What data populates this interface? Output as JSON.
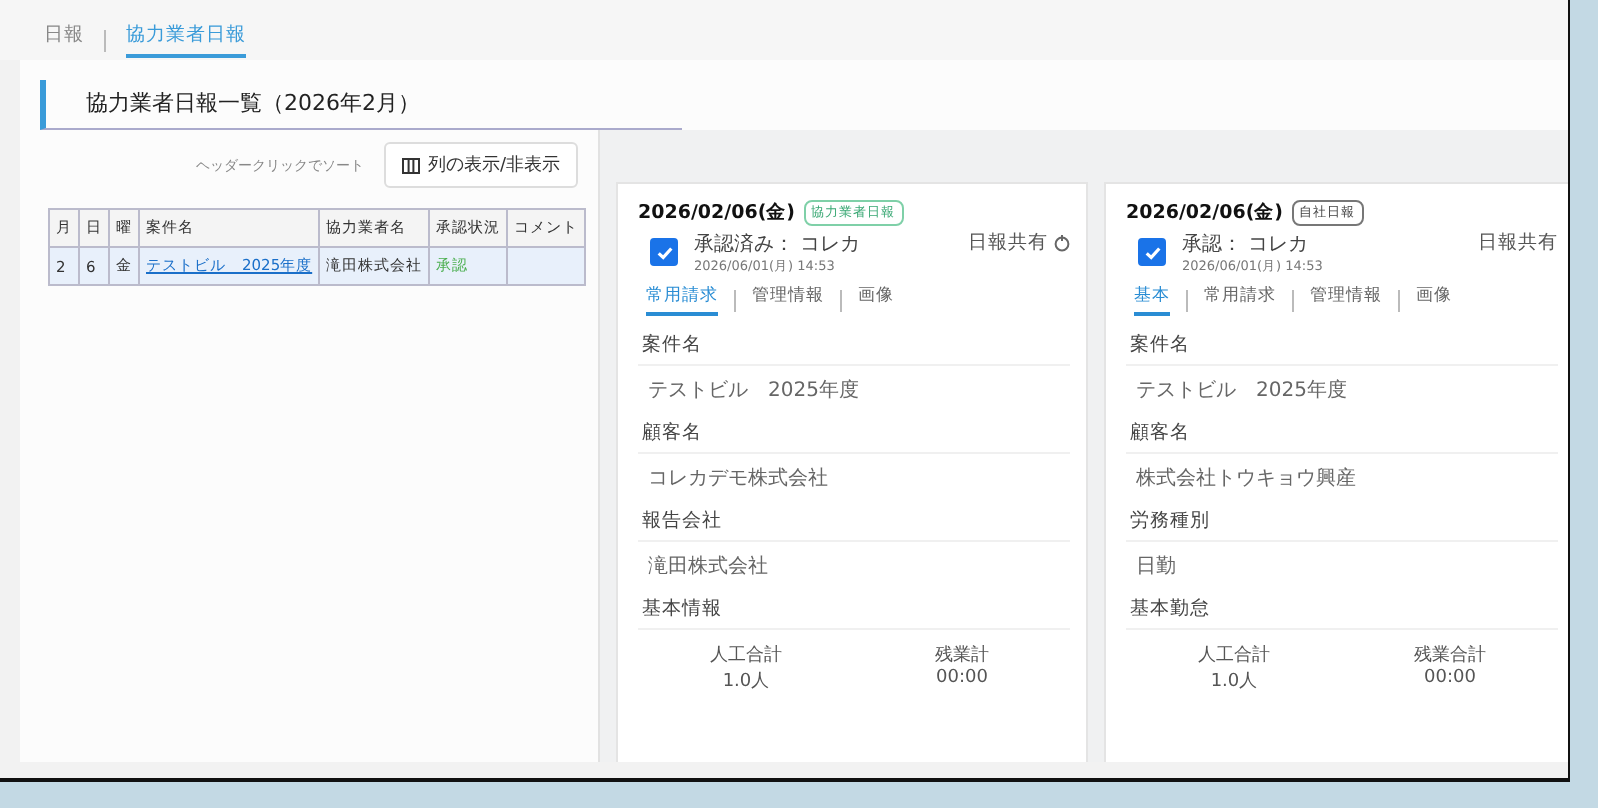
{
  "top_tabs": [
    {
      "label": "日報",
      "selected": false
    },
    {
      "label": "協力業者日報",
      "selected": true
    }
  ],
  "heading": "協力業者日報一覧（2026年2月）",
  "sort_hint": "ヘッダークリックでソート",
  "column_toggle_button": "列の表示/非表示",
  "table": {
    "columns": [
      "月",
      "日",
      "曜",
      "案件名",
      "協力業者名",
      "承認状況",
      "コメント"
    ],
    "rows": [
      {
        "selected": true,
        "cells": [
          "2",
          "6",
          "金",
          "テストビル　2025年度",
          "滝田株式会社",
          "承認",
          ""
        ]
      }
    ]
  },
  "cards": [
    {
      "date": "2026/02/06(金)",
      "badge": {
        "label": "協力業者日報",
        "kind": "partner"
      },
      "checked": true,
      "approval": "承認済み： コレカ",
      "timestamp": "2026/06/01(月) 14:53",
      "share": "日報共有",
      "share_icon": true,
      "tabs": [
        {
          "label": "常用請求",
          "selected": true
        },
        {
          "label": "管理情報",
          "selected": false
        },
        {
          "label": "画像",
          "selected": false
        }
      ],
      "fields": [
        {
          "label": "案件名",
          "value": "テストビル　2025年度"
        },
        {
          "label": "顧客名",
          "value": "コレカデモ株式会社"
        },
        {
          "label": "報告会社",
          "value": "滝田株式会社"
        }
      ],
      "section": "基本情報",
      "stats": [
        {
          "label": "人工合計",
          "value": "1.0人"
        },
        {
          "label": "残業計",
          "value": "00:00"
        }
      ]
    },
    {
      "date": "2026/02/06(金)",
      "badge": {
        "label": "自社日報",
        "kind": "own"
      },
      "checked": true,
      "approval": "承認： コレカ",
      "timestamp": "2026/06/01(月) 14:53",
      "share": "日報共有",
      "share_icon": false,
      "tabs": [
        {
          "label": "基本",
          "selected": true
        },
        {
          "label": "常用請求",
          "selected": false
        },
        {
          "label": "管理情報",
          "selected": false
        },
        {
          "label": "画像",
          "selected": false
        }
      ],
      "fields": [
        {
          "label": "案件名",
          "value": "テストビル　2025年度"
        },
        {
          "label": "顧客名",
          "value": "株式会社トウキョウ興産"
        },
        {
          "label": "労務種別",
          "value": "日勤"
        }
      ],
      "section": "基本勤怠",
      "stats": [
        {
          "label": "人工合計",
          "value": "1.0人"
        },
        {
          "label": "残業合計",
          "value": "00:00"
        }
      ]
    }
  ]
}
